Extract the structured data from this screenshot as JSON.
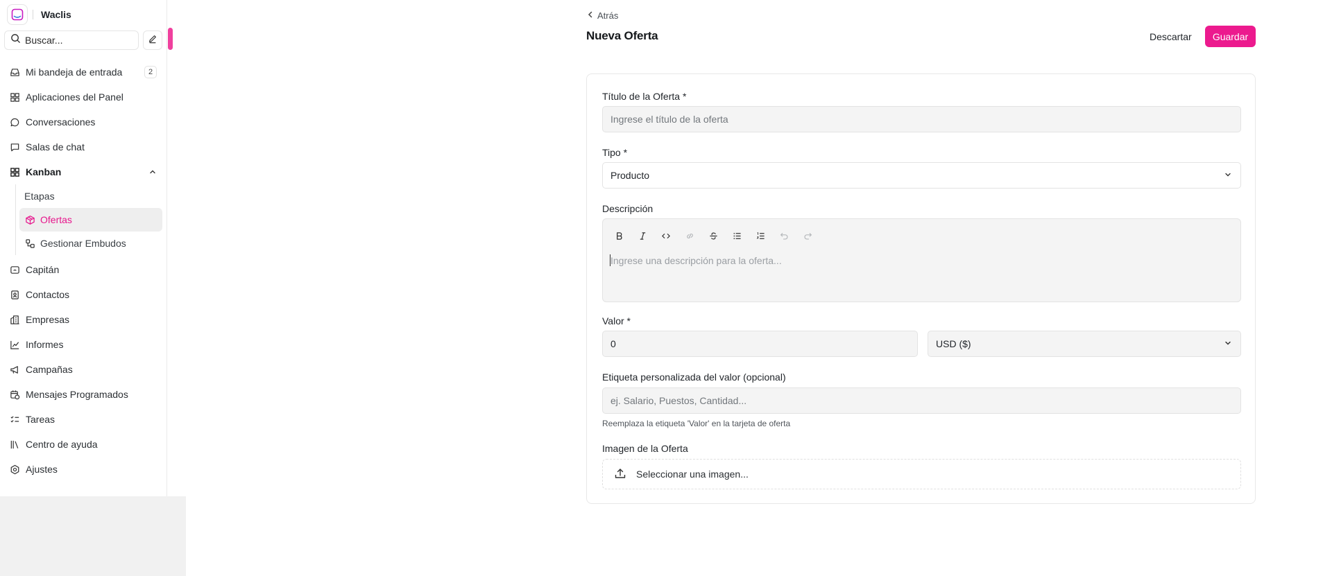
{
  "brand": {
    "name": "Waclis"
  },
  "search": {
    "placeholder": "Buscar..."
  },
  "nav": {
    "inbox": {
      "label": "Mi bandeja de entrada",
      "count": "2"
    },
    "dashboard_apps": "Aplicaciones del Panel",
    "conversations": "Conversaciones",
    "chat_rooms": "Salas de chat",
    "kanban": {
      "label": "Kanban",
      "children": [
        "Etapas",
        "Ofertas",
        "Gestionar Embudos"
      ]
    },
    "captain": "Capitán",
    "contacts": "Contactos",
    "companies": "Empresas",
    "reports": "Informes",
    "campaigns": "Campañas",
    "scheduled_messages": "Mensajes Programados",
    "tasks": "Tareas",
    "help_center": "Centro de ayuda",
    "settings": "Ajustes"
  },
  "header": {
    "back": "Atrás",
    "title": "Nueva Oferta",
    "discard": "Descartar",
    "save": "Guardar"
  },
  "form": {
    "title_label": "Título de la Oferta *",
    "title_placeholder": "Ingrese el título de la oferta",
    "type_label": "Tipo *",
    "type_value": "Producto",
    "description_label": "Descripción",
    "description_placeholder": "Ingrese una descripción para la oferta...",
    "value_label": "Valor *",
    "value": "0",
    "currency": "USD ($)",
    "custom_label_label": "Etiqueta personalizada del valor (opcional)",
    "custom_label_placeholder": "ej. Salario, Puestos, Cantidad...",
    "custom_label_hint": "Reemplaza la etiqueta 'Valor' en la tarjeta de oferta",
    "image_label": "Imagen de la Oferta",
    "image_button": "Seleccionar una imagen..."
  },
  "colors": {
    "accent": "#ec1a8e",
    "active_text": "#e6168c"
  }
}
